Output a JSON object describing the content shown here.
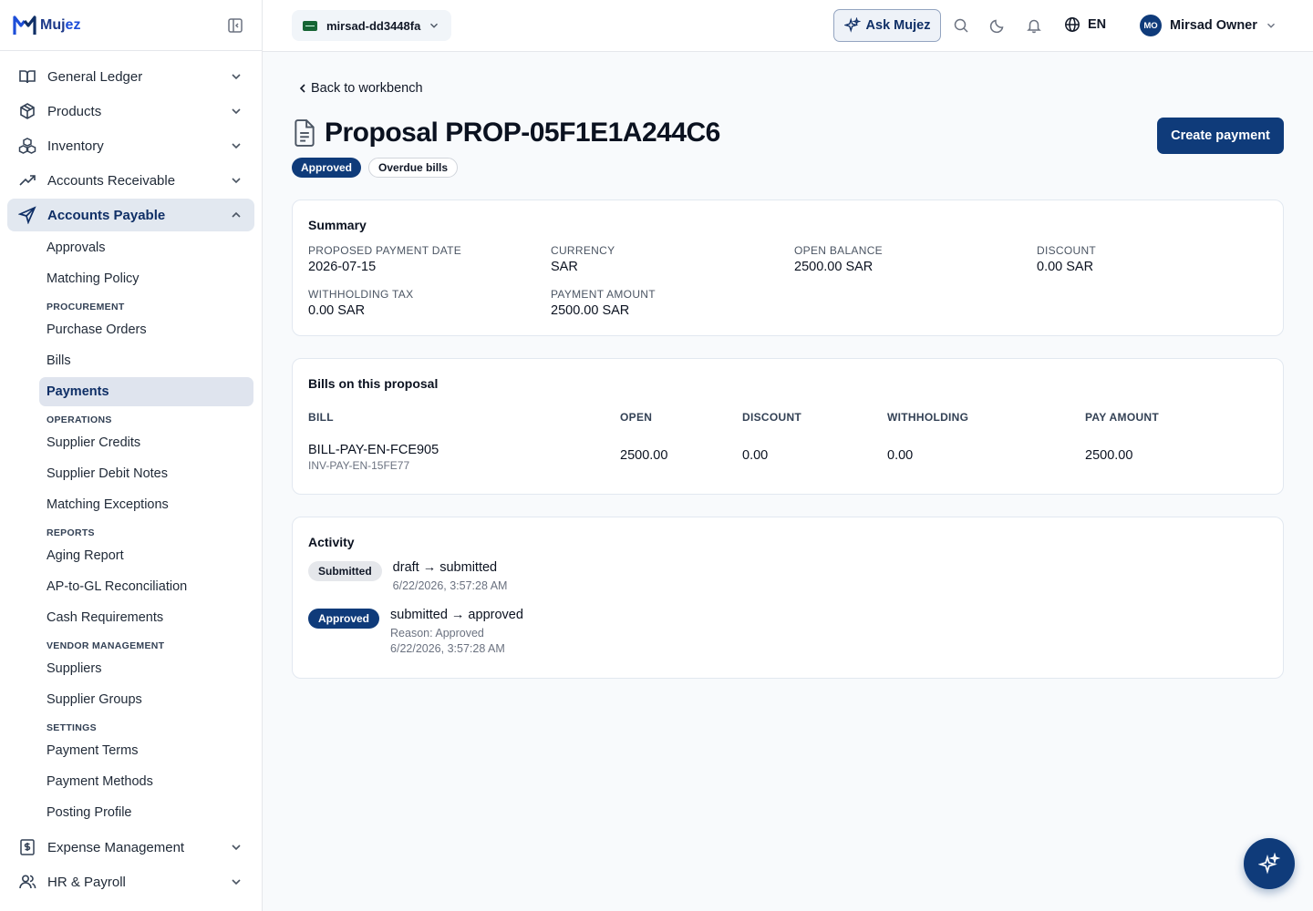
{
  "brand": {
    "name_a": "Muj",
    "name_b": "ez"
  },
  "sidebar": {
    "items": [
      {
        "label": "General Ledger",
        "icon": "book-icon"
      },
      {
        "label": "Products",
        "icon": "package-icon"
      },
      {
        "label": "Inventory",
        "icon": "boxes-icon"
      },
      {
        "label": "Accounts Receivable",
        "icon": "trending-up-icon"
      },
      {
        "label": "Accounts Payable",
        "icon": "send-icon"
      }
    ],
    "ap_sub": {
      "approvals": "Approvals",
      "matching_policy": "Matching Policy",
      "procurement_head": "PROCUREMENT",
      "purchase_orders": "Purchase Orders",
      "bills": "Bills",
      "payments": "Payments",
      "operations_head": "OPERATIONS",
      "supplier_credits": "Supplier Credits",
      "supplier_debit_notes": "Supplier Debit Notes",
      "matching_exceptions": "Matching Exceptions",
      "reports_head": "REPORTS",
      "aging_report": "Aging Report",
      "ap_gl": "AP-to-GL Reconciliation",
      "cash_requirements": "Cash Requirements",
      "vendor_head": "VENDOR MANAGEMENT",
      "suppliers": "Suppliers",
      "supplier_groups": "Supplier Groups",
      "settings_head": "SETTINGS",
      "payment_terms": "Payment Terms",
      "payment_methods": "Payment Methods",
      "posting_profile": "Posting Profile"
    },
    "bottom_items": [
      {
        "label": "Expense Management",
        "icon": "dollar-doc-icon"
      },
      {
        "label": "HR & Payroll",
        "icon": "users-icon"
      }
    ]
  },
  "topbar": {
    "org": "mirsad-dd3448fa",
    "ask": "Ask Mujez",
    "lang": "EN",
    "user_initials": "MO",
    "user_name": "Mirsad Owner"
  },
  "page": {
    "back": "Back to workbench",
    "title": "Proposal PROP-05F1E1A244C6",
    "badges": [
      "Approved",
      "Overdue bills"
    ],
    "create_btn": "Create payment"
  },
  "summary": {
    "title": "Summary",
    "fields": [
      {
        "label": "PROPOSED PAYMENT DATE",
        "value": "2026-07-15"
      },
      {
        "label": "CURRENCY",
        "value": "SAR"
      },
      {
        "label": "OPEN BALANCE",
        "value": "2500.00 SAR"
      },
      {
        "label": "DISCOUNT",
        "value": "0.00 SAR"
      },
      {
        "label": "WITHHOLDING TAX",
        "value": "0.00 SAR"
      },
      {
        "label": "PAYMENT AMOUNT",
        "value": "2500.00 SAR"
      }
    ]
  },
  "bills": {
    "title": "Bills on this proposal",
    "headers": [
      "BILL",
      "OPEN",
      "DISCOUNT",
      "WITHHOLDING",
      "PAY AMOUNT"
    ],
    "rows": [
      {
        "bill": "BILL-PAY-EN-FCE905",
        "ref": "INV-PAY-EN-15FE77",
        "open": "2500.00",
        "discount": "0.00",
        "withholding": "0.00",
        "pay": "2500.00"
      }
    ]
  },
  "activity": {
    "title": "Activity",
    "entries": [
      {
        "badge": "Submitted",
        "text": "draft → submitted",
        "time": "6/22/2026, 3:57:28 AM"
      },
      {
        "badge": "Approved",
        "text": "submitted → approved",
        "reason": "Reason: Approved",
        "time": "6/22/2026, 3:57:28 AM"
      }
    ]
  },
  "colors": {
    "primary": "#0f3b7a",
    "active_bg": "#e2e8f0"
  }
}
